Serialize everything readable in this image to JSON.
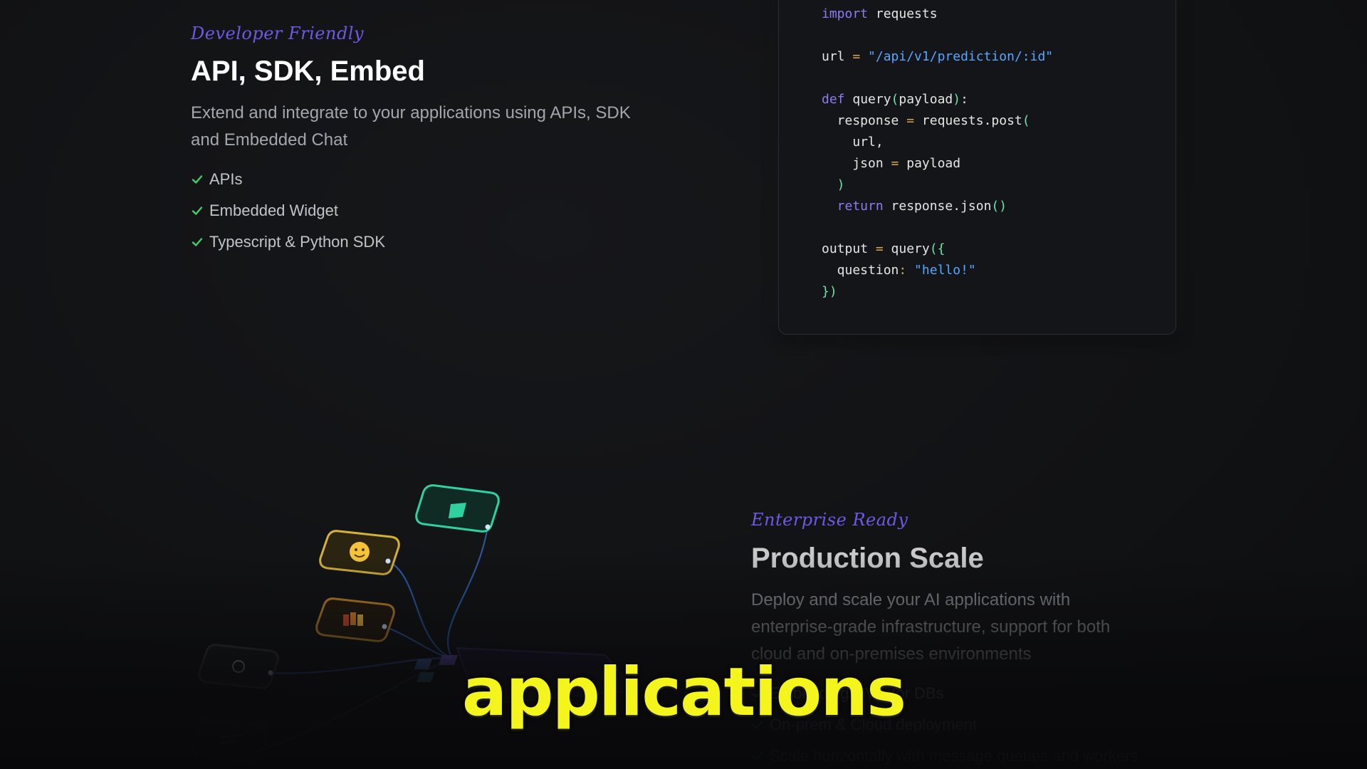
{
  "developer": {
    "eyebrow": "Developer Friendly",
    "title": "API, SDK, Embed",
    "description_line1": "Extend and integrate to your applications using APIs, SDK",
    "description_line2": "and Embedded Chat",
    "features": [
      "APIs",
      "Embedded Widget",
      "Typescript & Python SDK"
    ]
  },
  "code": {
    "l1_kw": "import",
    "l1_rest": " requests",
    "l3_a": "url ",
    "l3_op": "=",
    "l3_str": " \"/api/v1/prediction/:id\"",
    "l5_kw": "def",
    "l5_a": " query",
    "l5_p1": "(",
    "l5_b": "payload",
    "l5_p2": ")",
    "l5_c": ":",
    "l6_a": "  response ",
    "l6_op": "=",
    "l6_b": " requests.post",
    "l6_p": "(",
    "l7": "    url,",
    "l8_a": "    json ",
    "l8_op": "=",
    "l8_b": " payload",
    "l9": "  )",
    "l10_kw": "  return",
    "l10_a": " response.json",
    "l10_p": "()",
    "l12_a": "output ",
    "l12_op": "=",
    "l12_b": " query",
    "l12_p": "({",
    "l13_a": "  question",
    "l13_op": ":",
    "l13_str": " \"hello!\"",
    "l14": "})"
  },
  "enterprise": {
    "eyebrow": "Enterprise Ready",
    "title": "Production Scale",
    "description_line1": "Deploy and scale your AI applications with",
    "description_line2": "enterprise-grade infrastructure, support for both",
    "description_line3": "cloud and on-premises environments",
    "features": [
      "Embeddings, Vector DBs",
      "On-prem & Cloud deployment",
      "Scale horizontally with message queues and workers"
    ]
  },
  "caption": "applications",
  "colors": {
    "accent": "#6e58e6",
    "check": "#3fcf6b",
    "caption": "#f3f51c"
  }
}
